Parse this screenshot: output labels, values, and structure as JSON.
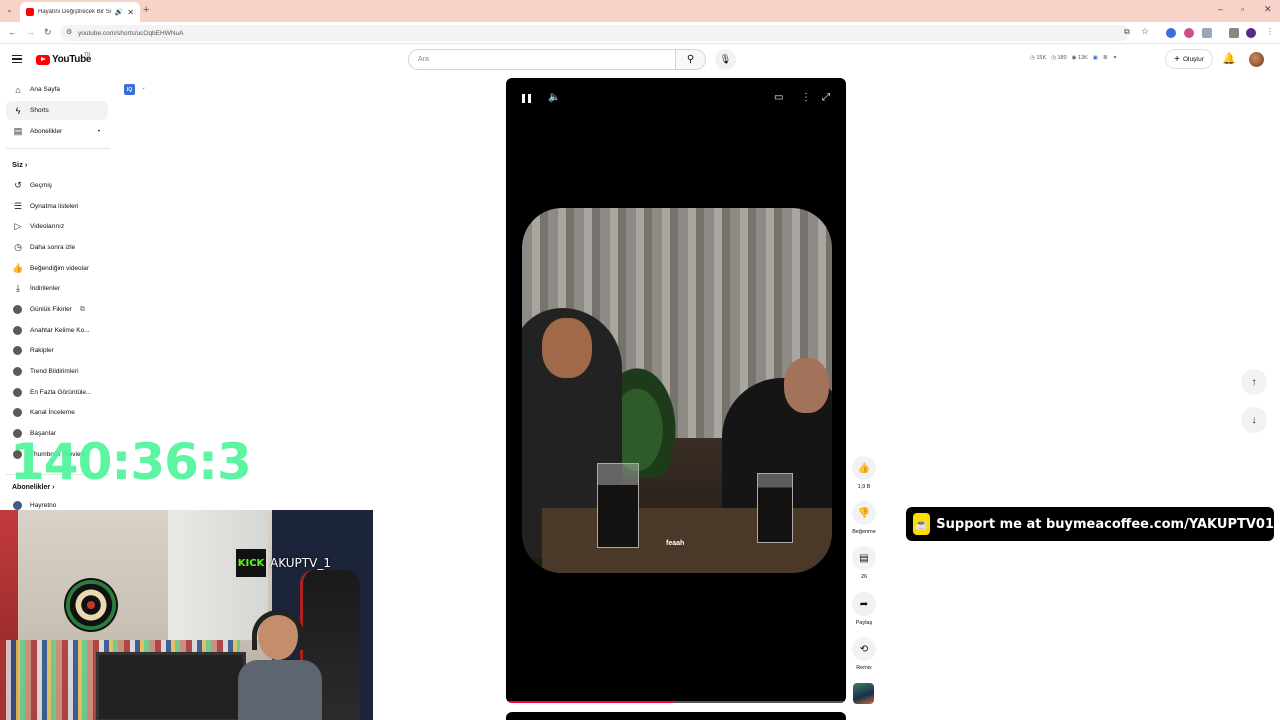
{
  "browser": {
    "tab_title": "Hayatını Değiştirecek Bir Sö",
    "url": "youtube.com/shorts/ucOqbEHWNuA"
  },
  "header": {
    "logo_text": "YouTube",
    "country_code": "TR",
    "search_placeholder": "Ara",
    "stats": [
      "15K",
      "180",
      "13K"
    ],
    "create_label": "Oluştur"
  },
  "sidebar": {
    "main": [
      {
        "label": "Ana Sayfa",
        "icon": "home-icon"
      },
      {
        "label": "Shorts",
        "icon": "shorts-icon"
      },
      {
        "label": "Abonelikler",
        "icon": "subscriptions-icon"
      }
    ],
    "you_header": "Siz",
    "you_items": [
      {
        "label": "Geçmiş",
        "icon": "history-icon"
      },
      {
        "label": "Oynatma listeleri",
        "icon": "playlist-icon"
      },
      {
        "label": "Videolarınız",
        "icon": "your-videos-icon"
      },
      {
        "label": "Daha sonra izle",
        "icon": "watch-later-icon"
      },
      {
        "label": "Beğendiğim videolar",
        "icon": "liked-icon"
      },
      {
        "label": "İndirilenler",
        "icon": "download-icon"
      }
    ],
    "tools": [
      "Günlük Fikirler",
      "Anahtar Kelime Ko...",
      "Rakipler",
      "Trend Bildirimleri",
      "En Fazla Görüntüle...",
      "Kanal İnceleme",
      "Başarılar",
      "Thumbnail Preview"
    ],
    "subs_header": "Abonelikler",
    "partial_item": "Hayretno"
  },
  "overlay": {
    "timer": "140:36:3",
    "kick_logo": "KICK",
    "kick_name": "AKUPTV_1",
    "support_text": "Support me at buymeacoffee.com/YAKUPTV01"
  },
  "player": {
    "subtitle": "feaah",
    "progress": 0.49
  },
  "actions": {
    "likes": "1,9 B",
    "dislike_label": "Beğenme",
    "comments": "26",
    "share_label": "Paylaş",
    "remix_label": "Remix"
  }
}
